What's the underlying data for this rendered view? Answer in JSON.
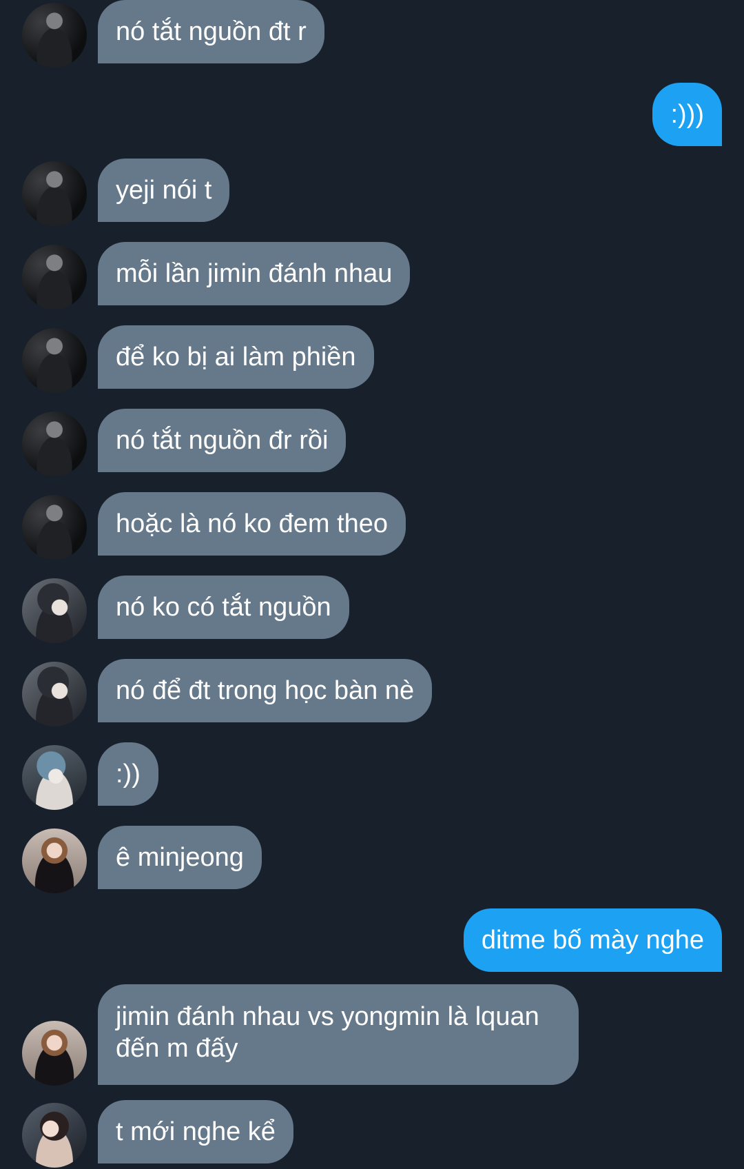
{
  "messages": [
    {
      "direction": "in",
      "avatar": "user-avatar-dark",
      "text": "nó tắt nguồn đt r"
    },
    {
      "direction": "out",
      "text": ":)))"
    },
    {
      "direction": "in",
      "avatar": "user-avatar-dark",
      "text": "yeji nói t"
    },
    {
      "direction": "in",
      "avatar": "user-avatar-dark",
      "text": "mỗi lần jimin đánh nhau"
    },
    {
      "direction": "in",
      "avatar": "user-avatar-dark",
      "text": "để ko bị ai làm phiền"
    },
    {
      "direction": "in",
      "avatar": "user-avatar-dark",
      "text": "nó tắt nguồn đr rồi"
    },
    {
      "direction": "in",
      "avatar": "user-avatar-dark",
      "text": "hoặc là nó ko đem theo"
    },
    {
      "direction": "in",
      "avatar": "user-avatar-boy",
      "text": "nó ko có tắt nguồn"
    },
    {
      "direction": "in",
      "avatar": "user-avatar-boy",
      "text": "nó để đt trong học bàn nè"
    },
    {
      "direction": "in",
      "avatar": "user-avatar-blue-hair",
      "text": ":))"
    },
    {
      "direction": "in",
      "avatar": "user-avatar-girl",
      "text": "ê minjeong"
    },
    {
      "direction": "out",
      "text": "ditme bố mày nghe"
    },
    {
      "direction": "in",
      "avatar": "user-avatar-girl",
      "text": "jimin đánh nhau vs yongmin là lquan đến m đấy"
    },
    {
      "direction": "in",
      "avatar": "user-avatar-girl-2",
      "text": "t mới nghe kể"
    }
  ],
  "colors": {
    "background": "#18202b",
    "incoming_bubble": "#66798b",
    "outgoing_bubble": "#1da1f2",
    "text": "#ffffff"
  }
}
